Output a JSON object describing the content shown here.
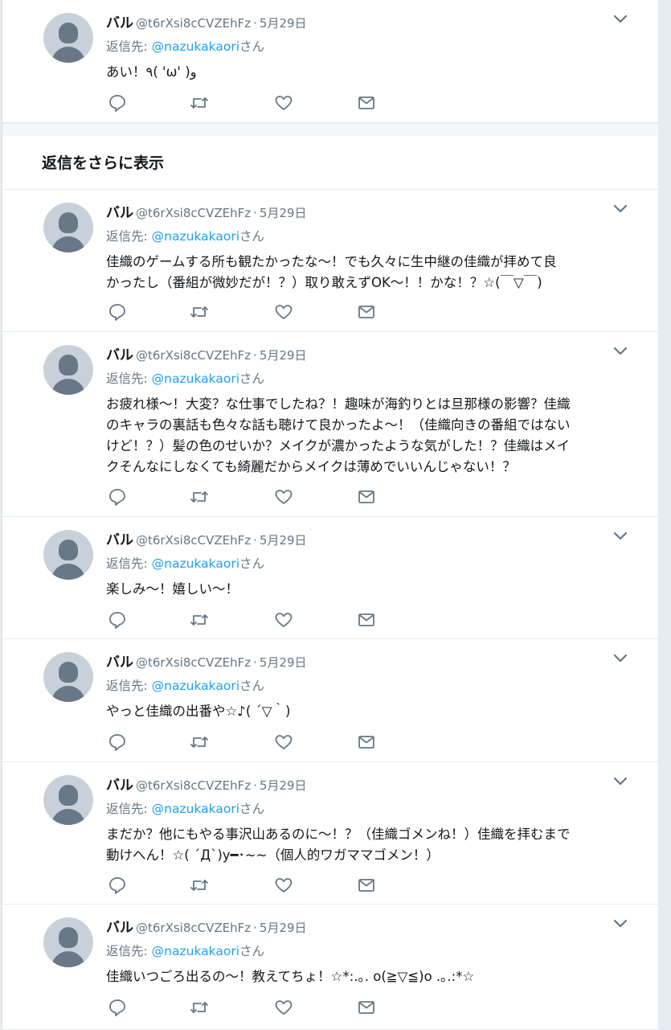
{
  "more_replies_heading": "返信をさらに表示",
  "colors": {
    "accent": "#1da1f2",
    "muted": "#657786",
    "text": "#14171a"
  },
  "tweets": [
    {
      "name": "バル",
      "handle": "@t6rXsi8cCVZEhFz",
      "separator": "·",
      "date": "5月29日",
      "reply_prefix": "返信先: ",
      "reply_mention": "@nazukakaori",
      "reply_suffix": "さん",
      "text": "あい！٩( 'ω' )و"
    },
    {
      "name": "バル",
      "handle": "@t6rXsi8cCVZEhFz",
      "separator": "·",
      "date": "5月29日",
      "reply_prefix": "返信先: ",
      "reply_mention": "@nazukakaori",
      "reply_suffix": "さん",
      "text": "佳織のゲームする所も観たかったな〜！でも久々に生中継の佳織が拝めて良\nかったし（番組が微妙だが！？）取り敢えずOK〜！！かな！？☆(￣▽￣)"
    },
    {
      "name": "バル",
      "handle": "@t6rXsi8cCVZEhFz",
      "separator": "·",
      "date": "5月29日",
      "reply_prefix": "返信先: ",
      "reply_mention": "@nazukakaori",
      "reply_suffix": "さん",
      "text": "お疲れ様〜！大変？な仕事でしたね？！趣味が海釣りとは旦那様の影響？佳織\nのキャラの裏話も色々な話も聴けて良かったよ〜！（佳織向きの番組ではない\nけど！？）髪の色のせいか？メイクが濃かったような気がした！？佳織はメイ\nクそんなにしなくても綺麗だからメイクは薄めでいいんじゃない！？"
    },
    {
      "name": "バル",
      "handle": "@t6rXsi8cCVZEhFz",
      "separator": "·",
      "date": "5月29日",
      "reply_prefix": "返信先: ",
      "reply_mention": "@nazukakaori",
      "reply_suffix": "さん",
      "text": "楽しみ〜！嬉しい〜！"
    },
    {
      "name": "バル",
      "handle": "@t6rXsi8cCVZEhFz",
      "separator": "·",
      "date": "5月29日",
      "reply_prefix": "返信先: ",
      "reply_mention": "@nazukakaori",
      "reply_suffix": "さん",
      "text": "やっと佳織の出番や☆♪( ´▽｀)"
    },
    {
      "name": "バル",
      "handle": "@t6rXsi8cCVZEhFz",
      "separator": "·",
      "date": "5月29日",
      "reply_prefix": "返信先: ",
      "reply_mention": "@nazukakaori",
      "reply_suffix": "さん",
      "text": "まだか？他にもやる事沢山あるのに〜！？（佳織ゴメンね！）佳織を拝むまで\n動けへん！☆( ´Д`)y━･~~（個人的ワガママゴメン！）"
    },
    {
      "name": "バル",
      "handle": "@t6rXsi8cCVZEhFz",
      "separator": "·",
      "date": "5月29日",
      "reply_prefix": "返信先: ",
      "reply_mention": "@nazukakaori",
      "reply_suffix": "さん",
      "text": "佳織いつごろ出るの〜！教えてちょ！☆*:.｡. o(≧▽≦)o .｡.:*☆"
    }
  ],
  "action_icons": [
    "reply-icon",
    "retweet-icon",
    "like-icon",
    "direct-message-icon"
  ]
}
